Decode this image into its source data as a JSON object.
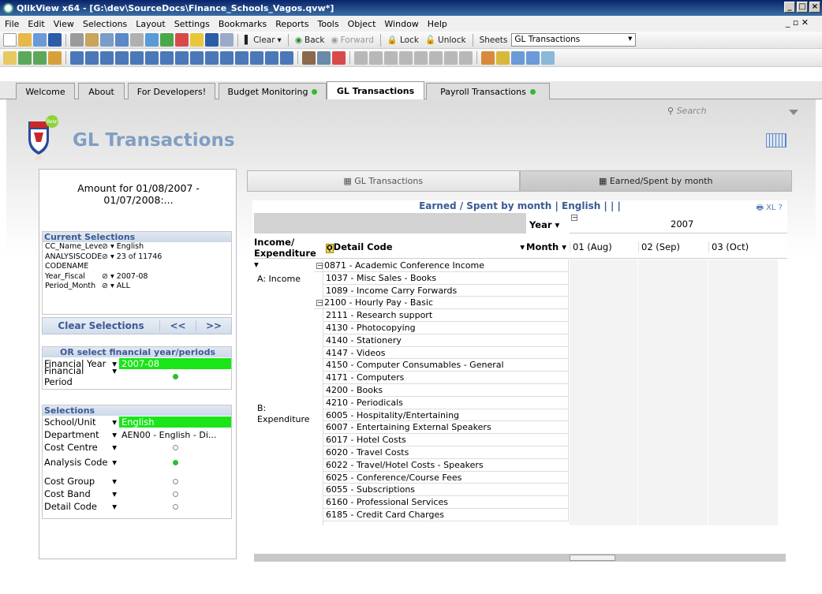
{
  "window": {
    "title": "QlikView x64 - [G:\\dev\\SourceDocs\\Finance_Schools_Vagos.qvw*]",
    "mdi": "_ ▫ ✕"
  },
  "menu": [
    "File",
    "Edit",
    "View",
    "Selections",
    "Layout",
    "Settings",
    "Bookmarks",
    "Reports",
    "Tools",
    "Object",
    "Window",
    "Help"
  ],
  "toolbar1": {
    "clear": "Clear",
    "back": "Back",
    "forward": "Forward",
    "lock": "Lock",
    "unlock": "Unlock",
    "sheets_label": "Sheets",
    "sheet_value": "GL Transactions"
  },
  "tabs": [
    {
      "label": "Welcome",
      "indicator": ""
    },
    {
      "label": "About",
      "indicator": ""
    },
    {
      "label": "For Developers!",
      "indicator": ""
    },
    {
      "label": "Budget Monitoring",
      "indicator": "green"
    },
    {
      "label": "GL Transactions",
      "indicator": ""
    },
    {
      "label": "Payroll Transactions",
      "indicator": "green"
    }
  ],
  "search_placeholder": "Search",
  "logo_badge": "Beta!",
  "page_title": "GL Transactions",
  "left": {
    "amount_line1": "Amount for 01/08/2007 -",
    "amount_line2": "01/07/2008:...",
    "current_selections_title": "Current Selections",
    "current_selections": [
      {
        "field": "CC_Name_Level4",
        "value": "English"
      },
      {
        "field": "ANALYSISCODE",
        "value": "23 of 11746"
      },
      {
        "field": "CODENAME",
        "value": ""
      },
      {
        "field": "Year_Fiscal",
        "value": "2007-08"
      },
      {
        "field": "Period_Month",
        "value": "ALL"
      }
    ],
    "clear_selections": "Clear Selections",
    "back": "<<",
    "forward": ">>",
    "or_select_title": "OR select financial year/periods",
    "financial_year_label": "Financial Year",
    "financial_year_value": "2007-08",
    "financial_period_label": "Financial Period",
    "selections_title": "Selections",
    "school_label": "School/Unit",
    "school_value": "English",
    "department_label": "Department",
    "department_value": "AEN00 - English - Di...",
    "cost_centre_label": "Cost Centre",
    "analysis_code_label": "Analysis Code",
    "cost_group_label": "Cost Group",
    "cost_band_label": "Cost Band",
    "detail_code_label": "Detail Code"
  },
  "buttons": {
    "gl": "GL Transactions",
    "earned": "Earned/Spent by month"
  },
  "table": {
    "caption": "Earned / Spent by month | English |  |  |",
    "caption_icons": "XL ?",
    "year_label": "Year",
    "year_value": "2007",
    "income_label": "Income/ Expenditure",
    "detail_label": "Detail Code",
    "month_label": "Month",
    "months": [
      "01 (Aug)",
      "02 (Sep)",
      "03 (Oct)"
    ],
    "group_income": "A: Income",
    "group_expenditure": "B: Expenditure",
    "rows": [
      "0871 - Academic Conference Income",
      "1037 - Misc Sales - Books",
      "1089 - Income Carry Forwards",
      "2100 - Hourly Pay - Basic",
      "2111 - Research support",
      "4130 - Photocopying",
      "4140 - Stationery",
      "4147 - Videos",
      "4150 - Computer Consumables - General",
      "4171 - Computers",
      "4200 - Books",
      "4210 - Periodicals",
      "6005 - Hospitality/Entertaining",
      "6007 - Entertaining External Speakers",
      "6017 - Hotel Costs",
      "6020 - Travel Costs",
      "6022 - Travel/Hotel Costs - Speakers",
      "6025 - Conference/Course Fees",
      "6055 - Subscriptions",
      "6160 - Professional Services",
      "6185 - Credit Card Charges"
    ]
  }
}
